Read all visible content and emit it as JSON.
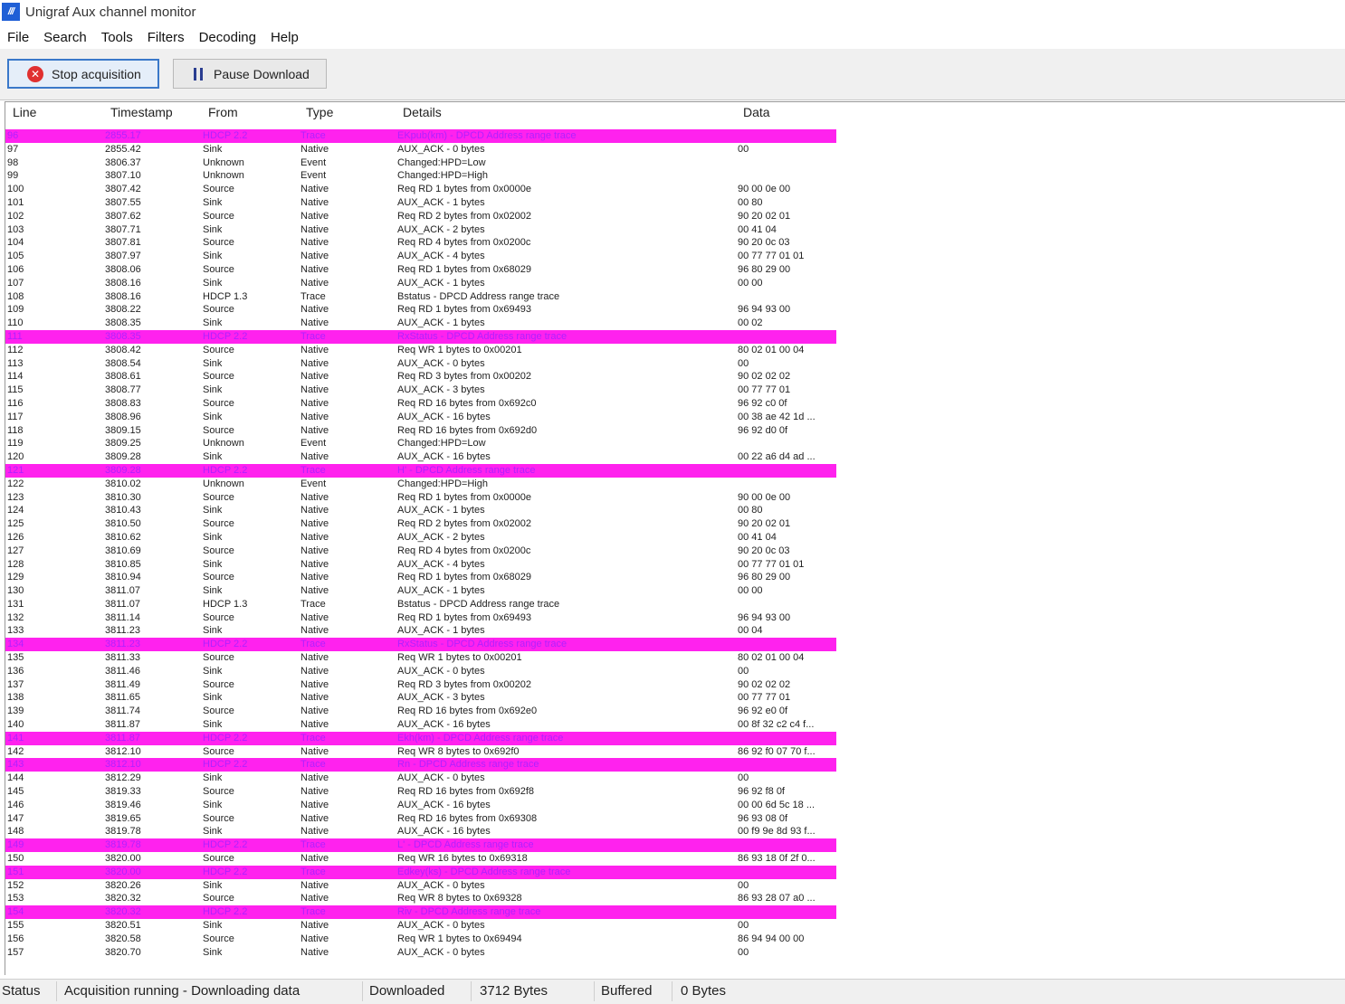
{
  "window": {
    "title": "Unigraf Aux channel monitor",
    "icon": "unigraf-logo-icon"
  },
  "menu": [
    "File",
    "Search",
    "Tools",
    "Filters",
    "Decoding",
    "Help"
  ],
  "toolbar": {
    "stop_label": "Stop acquisition",
    "pause_label": "Pause Download",
    "stop_icon_glyph": "✕"
  },
  "table": {
    "columns": [
      "Line",
      "Timestamp",
      "From",
      "Type",
      "Details",
      "Data"
    ],
    "rows": [
      {
        "line": "96",
        "ts": "2855.17",
        "from": "HDCP 2.2",
        "type": "Trace",
        "details": "EKpub(km) - DPCD Address range trace",
        "data": "",
        "trace": true
      },
      {
        "line": "97",
        "ts": "2855.42",
        "from": "Sink",
        "type": "Native",
        "details": "AUX_ACK - 0 bytes",
        "data": "00"
      },
      {
        "line": "98",
        "ts": "3806.37",
        "from": "Unknown",
        "type": "Event",
        "details": "Changed:HPD=Low",
        "data": ""
      },
      {
        "line": "99",
        "ts": "3807.10",
        "from": "Unknown",
        "type": "Event",
        "details": "Changed:HPD=High",
        "data": ""
      },
      {
        "line": "100",
        "ts": "3807.42",
        "from": "Source",
        "type": "Native",
        "details": "Req RD 1 bytes from 0x0000e",
        "data": "90 00 0e 00"
      },
      {
        "line": "101",
        "ts": "3807.55",
        "from": "Sink",
        "type": "Native",
        "details": "AUX_ACK - 1 bytes",
        "data": "00 80"
      },
      {
        "line": "102",
        "ts": "3807.62",
        "from": "Source",
        "type": "Native",
        "details": "Req RD 2 bytes from 0x02002",
        "data": "90 20 02 01"
      },
      {
        "line": "103",
        "ts": "3807.71",
        "from": "Sink",
        "type": "Native",
        "details": "AUX_ACK - 2 bytes",
        "data": "00 41 04"
      },
      {
        "line": "104",
        "ts": "3807.81",
        "from": "Source",
        "type": "Native",
        "details": "Req RD 4 bytes from 0x0200c",
        "data": "90 20 0c 03"
      },
      {
        "line": "105",
        "ts": "3807.97",
        "from": "Sink",
        "type": "Native",
        "details": "AUX_ACK - 4 bytes",
        "data": "00 77 77 01 01"
      },
      {
        "line": "106",
        "ts": "3808.06",
        "from": "Source",
        "type": "Native",
        "details": "Req RD 1 bytes from 0x68029",
        "data": "96 80 29 00"
      },
      {
        "line": "107",
        "ts": "3808.16",
        "from": "Sink",
        "type": "Native",
        "details": "AUX_ACK - 1 bytes",
        "data": "00 00"
      },
      {
        "line": "108",
        "ts": "3808.16",
        "from": "HDCP 1.3",
        "type": "Trace",
        "details": "Bstatus - DPCD Address range trace",
        "data": ""
      },
      {
        "line": "109",
        "ts": "3808.22",
        "from": "Source",
        "type": "Native",
        "details": "Req RD 1 bytes from 0x69493",
        "data": "96 94 93 00"
      },
      {
        "line": "110",
        "ts": "3808.35",
        "from": "Sink",
        "type": "Native",
        "details": "AUX_ACK - 1 bytes",
        "data": "00 02"
      },
      {
        "line": "111",
        "ts": "3808.35",
        "from": "HDCP 2.2",
        "type": "Trace",
        "details": "RxStatus - DPCD Address range trace",
        "data": "",
        "trace": true
      },
      {
        "line": "112",
        "ts": "3808.42",
        "from": "Source",
        "type": "Native",
        "details": "Req WR 1 bytes to 0x00201",
        "data": "80 02 01 00 04"
      },
      {
        "line": "113",
        "ts": "3808.54",
        "from": "Sink",
        "type": "Native",
        "details": "AUX_ACK - 0 bytes",
        "data": "00"
      },
      {
        "line": "114",
        "ts": "3808.61",
        "from": "Source",
        "type": "Native",
        "details": "Req RD 3 bytes from 0x00202",
        "data": "90 02 02 02"
      },
      {
        "line": "115",
        "ts": "3808.77",
        "from": "Sink",
        "type": "Native",
        "details": "AUX_ACK - 3 bytes",
        "data": "00 77 77 01"
      },
      {
        "line": "116",
        "ts": "3808.83",
        "from": "Source",
        "type": "Native",
        "details": "Req RD 16 bytes from 0x692c0",
        "data": "96 92 c0 0f"
      },
      {
        "line": "117",
        "ts": "3808.96",
        "from": "Sink",
        "type": "Native",
        "details": "AUX_ACK - 16 bytes",
        "data": "00 38 ae 42 1d ..."
      },
      {
        "line": "118",
        "ts": "3809.15",
        "from": "Source",
        "type": "Native",
        "details": "Req RD 16 bytes from 0x692d0",
        "data": "96 92 d0 0f"
      },
      {
        "line": "119",
        "ts": "3809.25",
        "from": "Unknown",
        "type": "Event",
        "details": "Changed:HPD=Low",
        "data": ""
      },
      {
        "line": "120",
        "ts": "3809.28",
        "from": "Sink",
        "type": "Native",
        "details": "AUX_ACK - 16 bytes",
        "data": "00 22 a6 d4 ad ..."
      },
      {
        "line": "121",
        "ts": "3809.28",
        "from": "HDCP 2.2",
        "type": "Trace",
        "details": "H' - DPCD Address range trace",
        "data": "",
        "trace": true
      },
      {
        "line": "122",
        "ts": "3810.02",
        "from": "Unknown",
        "type": "Event",
        "details": "Changed:HPD=High",
        "data": ""
      },
      {
        "line": "123",
        "ts": "3810.30",
        "from": "Source",
        "type": "Native",
        "details": "Req RD 1 bytes from 0x0000e",
        "data": "90 00 0e 00"
      },
      {
        "line": "124",
        "ts": "3810.43",
        "from": "Sink",
        "type": "Native",
        "details": "AUX_ACK - 1 bytes",
        "data": "00 80"
      },
      {
        "line": "125",
        "ts": "3810.50",
        "from": "Source",
        "type": "Native",
        "details": "Req RD 2 bytes from 0x02002",
        "data": "90 20 02 01"
      },
      {
        "line": "126",
        "ts": "3810.62",
        "from": "Sink",
        "type": "Native",
        "details": "AUX_ACK - 2 bytes",
        "data": "00 41 04"
      },
      {
        "line": "127",
        "ts": "3810.69",
        "from": "Source",
        "type": "Native",
        "details": "Req RD 4 bytes from 0x0200c",
        "data": "90 20 0c 03"
      },
      {
        "line": "128",
        "ts": "3810.85",
        "from": "Sink",
        "type": "Native",
        "details": "AUX_ACK - 4 bytes",
        "data": "00 77 77 01 01"
      },
      {
        "line": "129",
        "ts": "3810.94",
        "from": "Source",
        "type": "Native",
        "details": "Req RD 1 bytes from 0x68029",
        "data": "96 80 29 00"
      },
      {
        "line": "130",
        "ts": "3811.07",
        "from": "Sink",
        "type": "Native",
        "details": "AUX_ACK - 1 bytes",
        "data": "00 00"
      },
      {
        "line": "131",
        "ts": "3811.07",
        "from": "HDCP 1.3",
        "type": "Trace",
        "details": "Bstatus - DPCD Address range trace",
        "data": ""
      },
      {
        "line": "132",
        "ts": "3811.14",
        "from": "Source",
        "type": "Native",
        "details": "Req RD 1 bytes from 0x69493",
        "data": "96 94 93 00"
      },
      {
        "line": "133",
        "ts": "3811.23",
        "from": "Sink",
        "type": "Native",
        "details": "AUX_ACK - 1 bytes",
        "data": "00 04"
      },
      {
        "line": "134",
        "ts": "3811.23",
        "from": "HDCP 2.2",
        "type": "Trace",
        "details": "RxStatus - DPCD Address range trace",
        "data": "",
        "trace": true
      },
      {
        "line": "135",
        "ts": "3811.33",
        "from": "Source",
        "type": "Native",
        "details": "Req WR 1 bytes to 0x00201",
        "data": "80 02 01 00 04"
      },
      {
        "line": "136",
        "ts": "3811.46",
        "from": "Sink",
        "type": "Native",
        "details": "AUX_ACK - 0 bytes",
        "data": "00"
      },
      {
        "line": "137",
        "ts": "3811.49",
        "from": "Source",
        "type": "Native",
        "details": "Req RD 3 bytes from 0x00202",
        "data": "90 02 02 02"
      },
      {
        "line": "138",
        "ts": "3811.65",
        "from": "Sink",
        "type": "Native",
        "details": "AUX_ACK - 3 bytes",
        "data": "00 77 77 01"
      },
      {
        "line": "139",
        "ts": "3811.74",
        "from": "Source",
        "type": "Native",
        "details": "Req RD 16 bytes from 0x692e0",
        "data": "96 92 e0 0f"
      },
      {
        "line": "140",
        "ts": "3811.87",
        "from": "Sink",
        "type": "Native",
        "details": "AUX_ACK - 16 bytes",
        "data": "00 8f 32 c2 c4 f..."
      },
      {
        "line": "141",
        "ts": "3811.87",
        "from": "HDCP 2.2",
        "type": "Trace",
        "details": "Ekh(km) - DPCD Address range trace",
        "data": "",
        "trace": true
      },
      {
        "line": "142",
        "ts": "3812.10",
        "from": "Source",
        "type": "Native",
        "details": "Req WR 8 bytes to 0x692f0",
        "data": "86 92 f0 07 70 f..."
      },
      {
        "line": "143",
        "ts": "3812.10",
        "from": "HDCP 2.2",
        "type": "Trace",
        "details": "Rn - DPCD Address range trace",
        "data": "",
        "trace": true
      },
      {
        "line": "144",
        "ts": "3812.29",
        "from": "Sink",
        "type": "Native",
        "details": "AUX_ACK - 0 bytes",
        "data": "00"
      },
      {
        "line": "145",
        "ts": "3819.33",
        "from": "Source",
        "type": "Native",
        "details": "Req RD 16 bytes from 0x692f8",
        "data": "96 92 f8 0f"
      },
      {
        "line": "146",
        "ts": "3819.46",
        "from": "Sink",
        "type": "Native",
        "details": "AUX_ACK - 16 bytes",
        "data": "00 00 6d 5c 18 ..."
      },
      {
        "line": "147",
        "ts": "3819.65",
        "from": "Source",
        "type": "Native",
        "details": "Req RD 16 bytes from 0x69308",
        "data": "96 93 08 0f"
      },
      {
        "line": "148",
        "ts": "3819.78",
        "from": "Sink",
        "type": "Native",
        "details": "AUX_ACK - 16 bytes",
        "data": "00 f9 9e 8d 93 f..."
      },
      {
        "line": "149",
        "ts": "3819.78",
        "from": "HDCP 2.2",
        "type": "Trace",
        "details": "L' - DPCD Address range trace",
        "data": "",
        "trace": true
      },
      {
        "line": "150",
        "ts": "3820.00",
        "from": "Source",
        "type": "Native",
        "details": "Req WR 16 bytes to 0x69318",
        "data": "86 93 18 0f 2f 0..."
      },
      {
        "line": "151",
        "ts": "3820.00",
        "from": "HDCP 2.2",
        "type": "Trace",
        "details": "Edkey(ks) - DPCD Address range trace",
        "data": "",
        "trace": true
      },
      {
        "line": "152",
        "ts": "3820.26",
        "from": "Sink",
        "type": "Native",
        "details": "AUX_ACK - 0 bytes",
        "data": "00"
      },
      {
        "line": "153",
        "ts": "3820.32",
        "from": "Source",
        "type": "Native",
        "details": "Req WR 8 bytes to 0x69328",
        "data": "86 93 28 07 a0 ..."
      },
      {
        "line": "154",
        "ts": "3820.32",
        "from": "HDCP 2.2",
        "type": "Trace",
        "details": "Riv - DPCD Address range trace",
        "data": "",
        "trace": true
      },
      {
        "line": "155",
        "ts": "3820.51",
        "from": "Sink",
        "type": "Native",
        "details": "AUX_ACK - 0 bytes",
        "data": "00"
      },
      {
        "line": "156",
        "ts": "3820.58",
        "from": "Source",
        "type": "Native",
        "details": "Req WR 1 bytes to 0x69494",
        "data": "86 94 94 00 00"
      },
      {
        "line": "157",
        "ts": "3820.70",
        "from": "Sink",
        "type": "Native",
        "details": "AUX_ACK - 0 bytes",
        "data": "00"
      }
    ]
  },
  "status": {
    "label": "Status",
    "text": "Acquisition running - Downloading data",
    "downloaded_label": "Downloaded",
    "downloaded_value": "3712 Bytes",
    "buffered_label": "Buffered",
    "buffered_value": "0 Bytes"
  },
  "colors": {
    "trace_row_bg": "#ff22ee",
    "trace_row_text": "#b020ff",
    "stop_icon": "#e03030",
    "accent": "#3a78c9"
  }
}
